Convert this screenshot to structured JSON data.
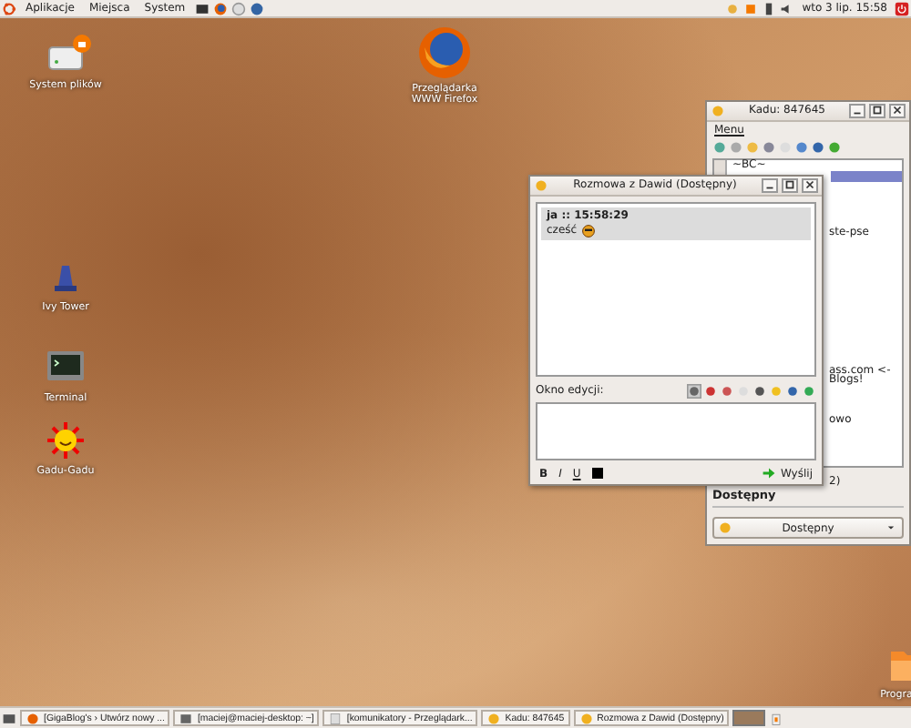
{
  "top_panel": {
    "menus": [
      "Aplikacje",
      "Miejsca",
      "System"
    ],
    "clock": "wto 3 lip. 15:58"
  },
  "desktop_icons": [
    {
      "kind": "drive",
      "label": "System plików"
    },
    {
      "kind": "browser",
      "label": "Przeglądarka WWW Firefox"
    },
    {
      "kind": "tower",
      "label": "Ivy Tower"
    },
    {
      "kind": "terminal",
      "label": "Terminal"
    },
    {
      "kind": "sun",
      "label": "Gadu-Gadu"
    },
    {
      "kind": "folder",
      "label": "Progra"
    }
  ],
  "kadu_window": {
    "title": "Kadu: 847645",
    "menu": "Menu",
    "contacts": [
      {
        "name": "~BC~",
        "selected": false
      },
      {
        "selected": true
      }
    ],
    "partly_hidden_texts": [
      "ste-pse",
      "ass.com <-",
      "Blogs!",
      "owo",
      "2)"
    ],
    "status_text": "Dostępny",
    "status_select": "Dostępny"
  },
  "chat_window": {
    "title": "Rozmowa z Dawid (Dostępny)",
    "messages": [
      {
        "header": "ja :: 15:58:29",
        "text": "cześć"
      }
    ],
    "edit_label": "Okno edycji:",
    "format_buttons": [
      "B",
      "I",
      "U"
    ],
    "send_button": "Wyślij"
  },
  "taskbar": {
    "tasks": [
      {
        "kind": "browser",
        "label": "[GigaBlog's › Utwórz nowy ..."
      },
      {
        "kind": "terminal",
        "label": "[maciej@maciej-desktop: ~]"
      },
      {
        "kind": "page",
        "label": "[komunikatory - Przeglądark..."
      },
      {
        "kind": "sun",
        "label": "Kadu: 847645"
      },
      {
        "kind": "sun",
        "label": "Rozmowa z Dawid (Dostępny)"
      }
    ]
  }
}
